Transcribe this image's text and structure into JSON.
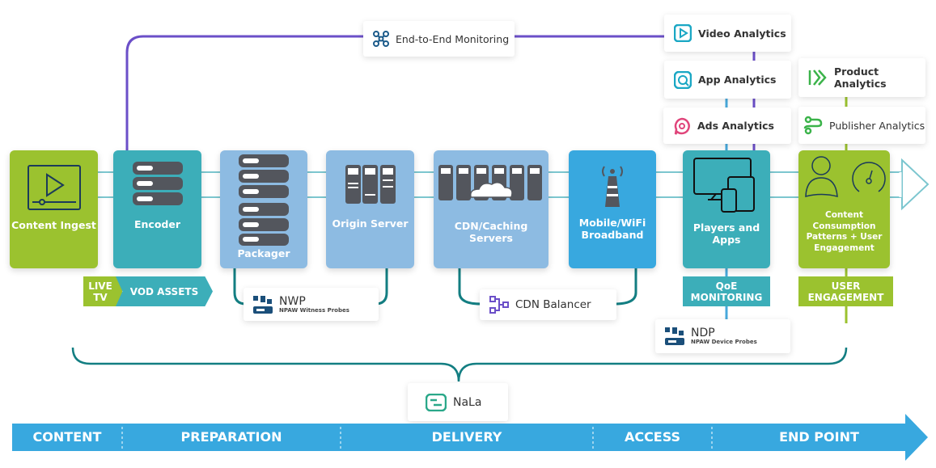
{
  "nodes": {
    "content_ingest": "Content Ingest",
    "encoder": "Encoder",
    "packager": "Packager",
    "origin": "Origin Server",
    "cdn": "CDN/Caching Servers",
    "mobile": "Mobile/WiFi Broadband",
    "players": "Players and Apps",
    "consumption": "Content Consumption Patterns + User Engagement"
  },
  "tags": {
    "live_tv": "LIVE TV",
    "vod": "VOD ASSETS",
    "qoe": "QoE MONITORING",
    "user_engagement": "USER ENGAGEMENT"
  },
  "cards": {
    "monitoring": "End-to-End Monitoring",
    "video": "Video Analytics",
    "app": "App Analytics",
    "ads": "Ads Analytics",
    "product": "Product Analytics",
    "publisher": "Publisher Analytics",
    "cdn_balancer": "CDN Balancer",
    "nala": "NaLa",
    "nwp": {
      "title": "NWP",
      "subtitle": "NPAW Witness Probes"
    },
    "ndp": {
      "title": "NDP",
      "subtitle": "NPAW Device Probes"
    }
  },
  "stages": [
    "CONTENT",
    "PREPARATION",
    "DELIVERY",
    "ACCESS",
    "END POINT"
  ],
  "colors": {
    "green": "#9bc22f",
    "teal": "#3caeb9",
    "light_blue": "#8dbbe2",
    "blue": "#38a8df",
    "purple": "#6b4fc8",
    "dark_teal": "#137e82"
  }
}
